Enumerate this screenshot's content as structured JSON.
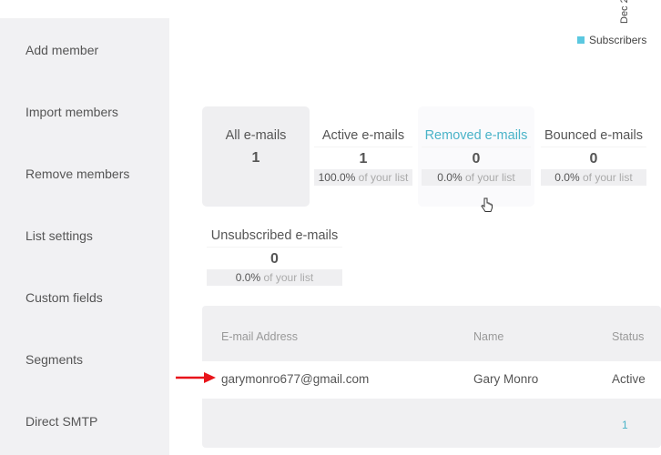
{
  "sidebar": {
    "items": [
      {
        "label": "Add member"
      },
      {
        "label": "Import members"
      },
      {
        "label": "Remove members"
      },
      {
        "label": "List settings"
      },
      {
        "label": "Custom fields"
      },
      {
        "label": "Segments"
      },
      {
        "label": "Direct SMTP"
      }
    ]
  },
  "chart": {
    "x_tick": "Dec 2",
    "legend": "Subscribers",
    "legend_color": "#5bc8e0"
  },
  "stats": [
    {
      "label": "All e-mails",
      "count": "1"
    },
    {
      "label": "Active e-mails",
      "count": "1",
      "pct": "100.0%",
      "suffix": "of your list"
    },
    {
      "label": "Removed e-mails",
      "count": "0",
      "pct": "0.0%",
      "suffix": "of your list"
    },
    {
      "label": "Bounced e-mails",
      "count": "0",
      "pct": "0.0%",
      "suffix": "of your list"
    },
    {
      "label": "Unsubscribed e-mails",
      "count": "0",
      "pct": "0.0%",
      "suffix": "of your list"
    }
  ],
  "table": {
    "headers": [
      "E-mail Address",
      "Name",
      "Status"
    ],
    "rows": [
      {
        "email": "garymonro677@gmail.com",
        "name": "Gary Monro",
        "status": "Active"
      }
    ],
    "page": "1"
  }
}
